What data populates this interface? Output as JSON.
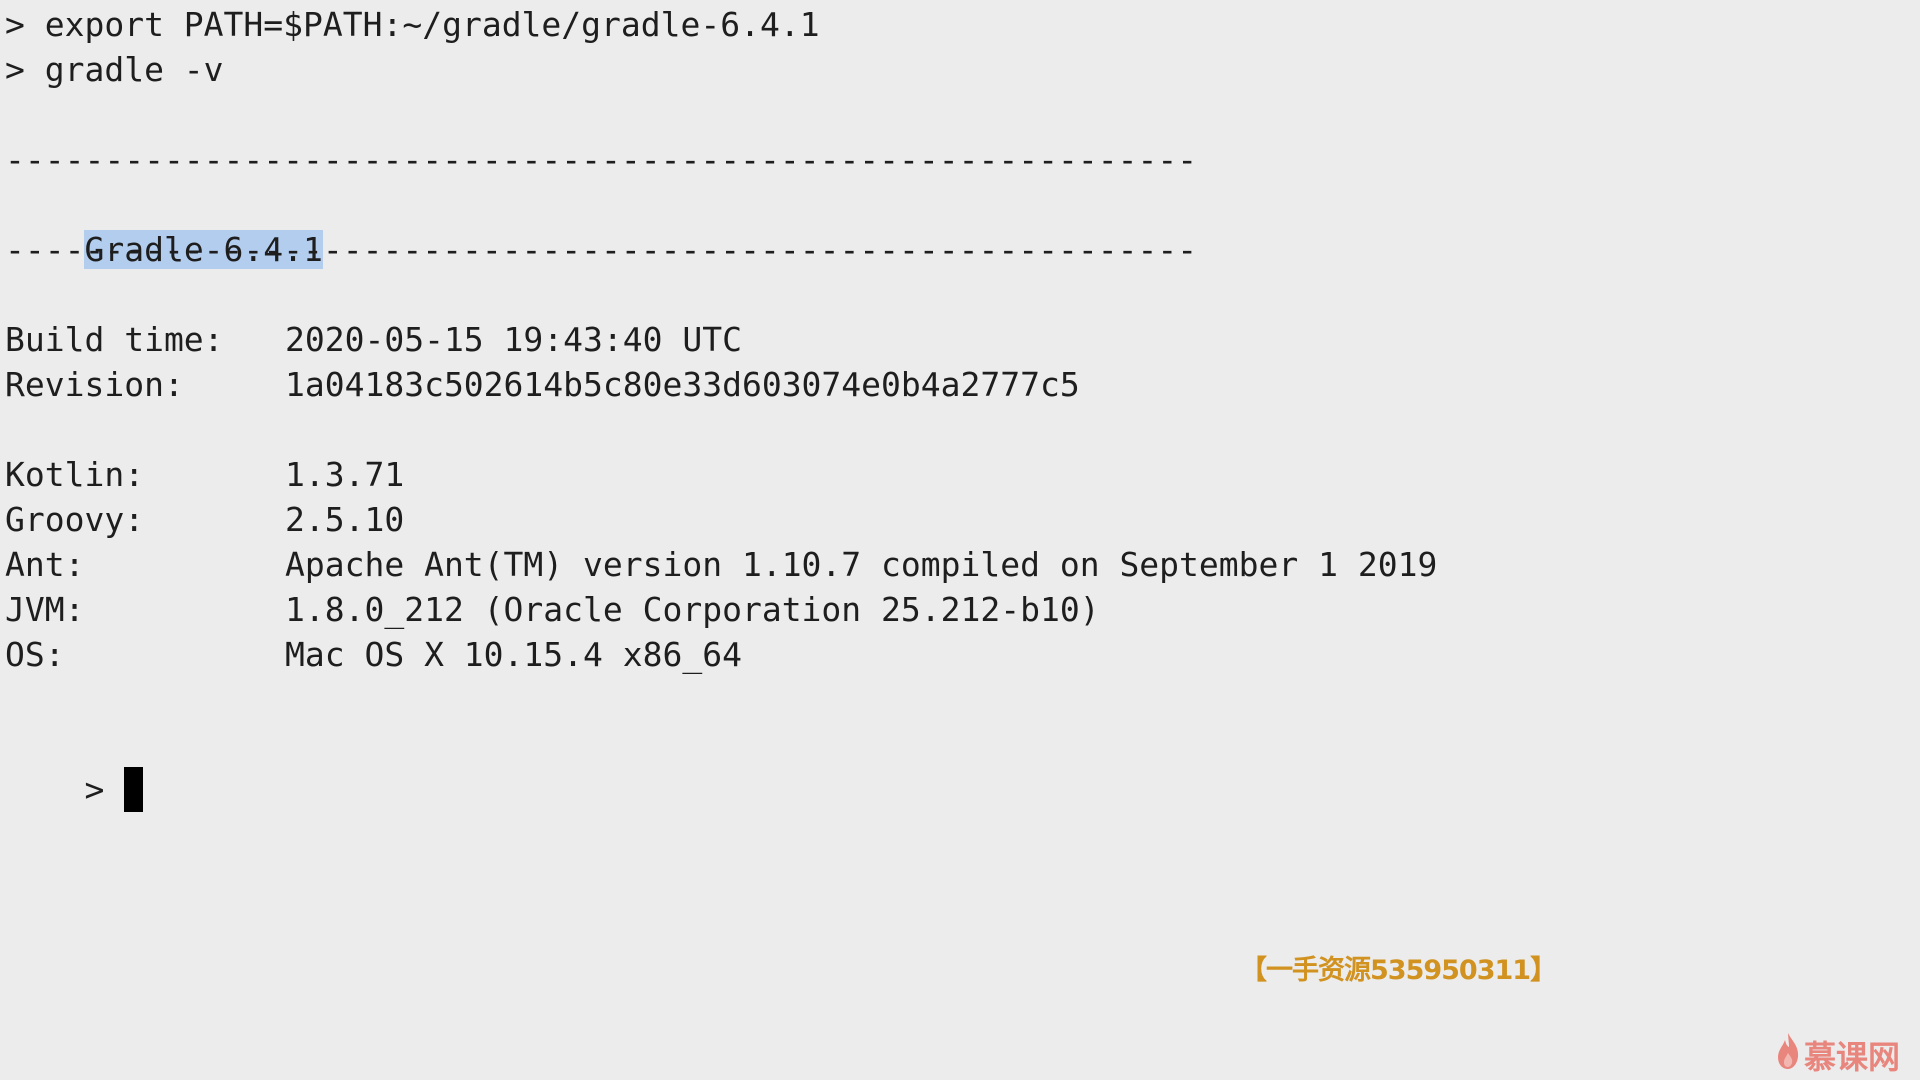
{
  "terminal": {
    "lines": {
      "cmd1": "> export PATH=$PATH:~/gradle/gradle-6.4.1",
      "cmd2": "> gradle -v",
      "sep1": "------------------------------------------------------------",
      "version": "Gradle 6.4.1",
      "sep2": "------------------------------------------------------------"
    },
    "info": {
      "build_time_label": "Build time:",
      "build_time_value": "2020-05-15 19:43:40 UTC",
      "revision_label": "Revision:",
      "revision_value": "1a04183c502614b5c80e33d603074e0b4a2777c5",
      "kotlin_label": "Kotlin:",
      "kotlin_value": "1.3.71",
      "groovy_label": "Groovy:",
      "groovy_value": "2.5.10",
      "ant_label": "Ant:",
      "ant_value": "Apache Ant(TM) version 1.10.7 compiled on September 1 2019",
      "jvm_label": "JVM:",
      "jvm_value": "1.8.0_212 (Oracle Corporation 25.212-b10)",
      "os_label": "OS:",
      "os_value": "Mac OS X 10.15.4 x86_64"
    },
    "prompt": ">"
  },
  "overlay": {
    "watermark": "【一手资源535950311】",
    "logo_text": "慕课网",
    "logo_icon": "flame-icon"
  },
  "colors": {
    "background": "#ececec",
    "text": "#1e1e1e",
    "selection": "#b3cdef",
    "watermark": "#d19220",
    "logo": "#e8867e"
  }
}
